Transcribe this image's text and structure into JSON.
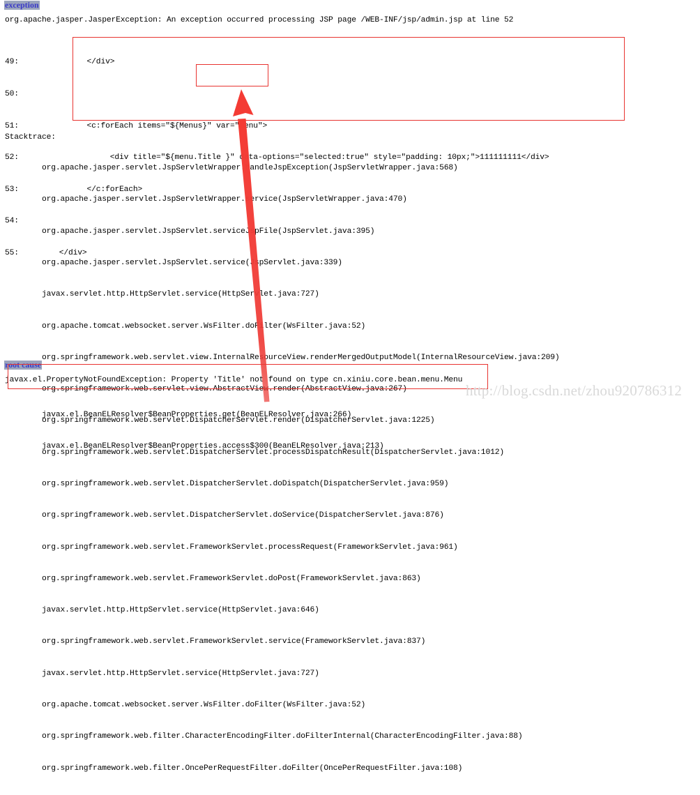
{
  "headings": {
    "exception": "exception",
    "root_cause": "root cause"
  },
  "messages": {
    "exception_line": "org.apache.jasper.JasperException: An exception occurred processing JSP page /WEB-INF/jsp/admin.jsp at line 52",
    "stacktrace_label": "Stacktrace:",
    "root_cause_line": "javax.el.PropertyNotFoundException: Property 'Title' not found on type cn.xiniu.core.bean.menu.Menu"
  },
  "code_block": {
    "lines": [
      {
        "number": "49:",
        "source": "            </div>"
      },
      {
        "number": "50:",
        "source": ""
      },
      {
        "number": "51:",
        "source": "            <c:forEach items=\"${Menus}\" var=\"menu\">"
      },
      {
        "number": "52:",
        "source": "                 <div title=\"${menu.Title }\" data-options=\"selected:true\" style=\"padding: 10px;\">111111111</div>"
      },
      {
        "number": "53:",
        "source": "            </c:forEach>"
      },
      {
        "number": "54:",
        "source": ""
      },
      {
        "number": "55:",
        "source": "      </div>"
      }
    ]
  },
  "stacktrace": {
    "frames": [
      "        org.apache.jasper.servlet.JspServletWrapper.handleJspException(JspServletWrapper.java:568)",
      "        org.apache.jasper.servlet.JspServletWrapper.service(JspServletWrapper.java:470)",
      "        org.apache.jasper.servlet.JspServlet.serviceJspFile(JspServlet.java:395)",
      "        org.apache.jasper.servlet.JspServlet.service(JspServlet.java:339)",
      "        javax.servlet.http.HttpServlet.service(HttpServlet.java:727)",
      "        org.apache.tomcat.websocket.server.WsFilter.doFilter(WsFilter.java:52)",
      "        org.springframework.web.servlet.view.InternalResourceView.renderMergedOutputModel(InternalResourceView.java:209)",
      "        org.springframework.web.servlet.view.AbstractView.render(AbstractView.java:267)",
      "        org.springframework.web.servlet.DispatcherServlet.render(DispatcherServlet.java:1225)",
      "        org.springframework.web.servlet.DispatcherServlet.processDispatchResult(DispatcherServlet.java:1012)",
      "        org.springframework.web.servlet.DispatcherServlet.doDispatch(DispatcherServlet.java:959)",
      "        org.springframework.web.servlet.DispatcherServlet.doService(DispatcherServlet.java:876)",
      "        org.springframework.web.servlet.FrameworkServlet.processRequest(FrameworkServlet.java:961)",
      "        org.springframework.web.servlet.FrameworkServlet.doPost(FrameworkServlet.java:863)",
      "        javax.servlet.http.HttpServlet.service(HttpServlet.java:646)",
      "        org.springframework.web.servlet.FrameworkServlet.service(FrameworkServlet.java:837)",
      "        javax.servlet.http.HttpServlet.service(HttpServlet.java:727)",
      "        org.apache.tomcat.websocket.server.WsFilter.doFilter(WsFilter.java:52)",
      "        org.springframework.web.filter.CharacterEncodingFilter.doFilterInternal(CharacterEncodingFilter.java:88)",
      "        org.springframework.web.filter.OncePerRequestFilter.doFilter(OncePerRequestFilter.java:108)"
    ]
  },
  "root_cause_trace": {
    "frames": [
      "        javax.el.BeanELResolver$BeanProperties.get(BeanELResolver.java:266)",
      "        javax.el.BeanELResolver$BeanProperties.access$300(BeanELResolver.java:213)"
    ]
  },
  "watermark": {
    "text": "http://blog.csdn.net/zhou920786312"
  },
  "annotations": {
    "color": "#e8332f",
    "code_box_label": "code-region-highlight",
    "title_box_label": "menu-title-expression-highlight",
    "root_cause_box_label": "root-cause-highlight",
    "arrow_label": "arrow-pointing-to-menu-title"
  }
}
